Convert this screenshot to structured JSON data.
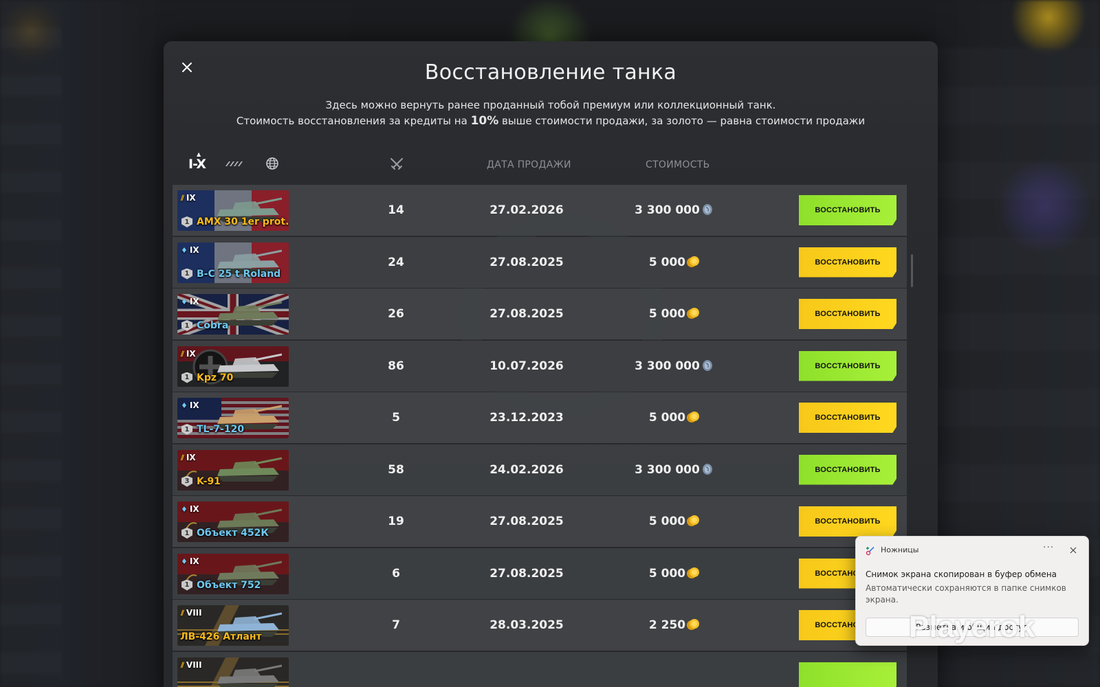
{
  "modal": {
    "title": "Восстановление танка",
    "subtitle_line1": "Здесь можно вернуть ранее проданный тобой премиум или коллекционный танк.",
    "subtitle_line2_pre": "Стоимость восстановления за кредиты на ",
    "subtitle_line2_bold": "10%",
    "subtitle_line2_post": " выше стоимости продажи, за золото — равна стоимости продажи"
  },
  "header": {
    "tier_filter": "I-X",
    "date_label": "ДАТА ПРОДАЖИ",
    "cost_label": "СТОИМОСТЬ"
  },
  "colors": {
    "credits_btn": "#9be832",
    "gold_btn": "#fcd21c",
    "premium_name": "#f8b91e",
    "collector_name": "#6ec8f0"
  },
  "rows": [
    {
      "tier": "IX",
      "name": "AMX 30 1er prot.",
      "name_color": "premium",
      "mastery": "1",
      "flag": "france",
      "battles": "14",
      "date": "27.02.2026",
      "cost": "3 300 000",
      "currency": "credits",
      "button": "ВОССТАНОВИТЬ"
    },
    {
      "tier": "IX",
      "name": "B-C 25 t Roland",
      "name_color": "collector",
      "mastery": "1",
      "flag": "france",
      "battles": "24",
      "date": "27.08.2025",
      "cost": "5 000",
      "currency": "gold",
      "button": "ВОССТАНОВИТЬ"
    },
    {
      "tier": "IX",
      "name": "Cobra",
      "name_color": "collector",
      "mastery": "1",
      "flag": "uk",
      "battles": "26",
      "date": "27.08.2025",
      "cost": "5 000",
      "currency": "gold",
      "button": "ВОССТАНОВИТЬ"
    },
    {
      "tier": "IX",
      "name": "Kpz 70",
      "name_color": "premium",
      "mastery": "1",
      "flag": "germany",
      "battles": "86",
      "date": "10.07.2026",
      "cost": "3 300 000",
      "currency": "credits",
      "button": "ВОССТАНОВИТЬ"
    },
    {
      "tier": "IX",
      "name": "TL-7-120",
      "name_color": "collector",
      "mastery": "1",
      "flag": "usa",
      "battles": "5",
      "date": "23.12.2023",
      "cost": "5 000",
      "currency": "gold",
      "button": "ВОССТАНОВИТЬ"
    },
    {
      "tier": "IX",
      "name": "K-91",
      "name_color": "premium",
      "mastery": "3",
      "flag": "ussr",
      "battles": "58",
      "date": "24.02.2026",
      "cost": "3 300 000",
      "currency": "credits",
      "button": "ВОССТАНОВИТЬ"
    },
    {
      "tier": "IX",
      "name": "Объект 452К",
      "name_color": "collector",
      "mastery": "1",
      "flag": "ussr",
      "battles": "19",
      "date": "27.08.2025",
      "cost": "5 000",
      "currency": "gold",
      "button": "ВОССТАНОВИТЬ"
    },
    {
      "tier": "IX",
      "name": "Объект 752",
      "name_color": "collector",
      "mastery": "1",
      "flag": "ussr",
      "battles": "6",
      "date": "27.08.2025",
      "cost": "5 000",
      "currency": "gold",
      "button": "ВОССТАНОВИТЬ"
    },
    {
      "tier": "VIII",
      "name": "ЛВ-426 Атлант",
      "name_color": "premium",
      "mastery": "",
      "flag": "other",
      "battles": "7",
      "date": "28.03.2025",
      "cost": "2 250",
      "currency": "gold",
      "button": "ВОССТАНОВИТЬ"
    },
    {
      "tier": "VIII",
      "name": "",
      "name_color": "premium",
      "mastery": "",
      "flag": "other",
      "battles": "",
      "date": "",
      "cost": "",
      "currency": "credits",
      "button": ""
    }
  ],
  "toast": {
    "app_name": "Ножницы",
    "more": "···",
    "title": "Снимок экрана скопирован в буфер обмена",
    "body": "Автоматически сохраняются в папке снимков экрана.",
    "button": "Разметка и общий доступ"
  },
  "watermark": "Playerok"
}
